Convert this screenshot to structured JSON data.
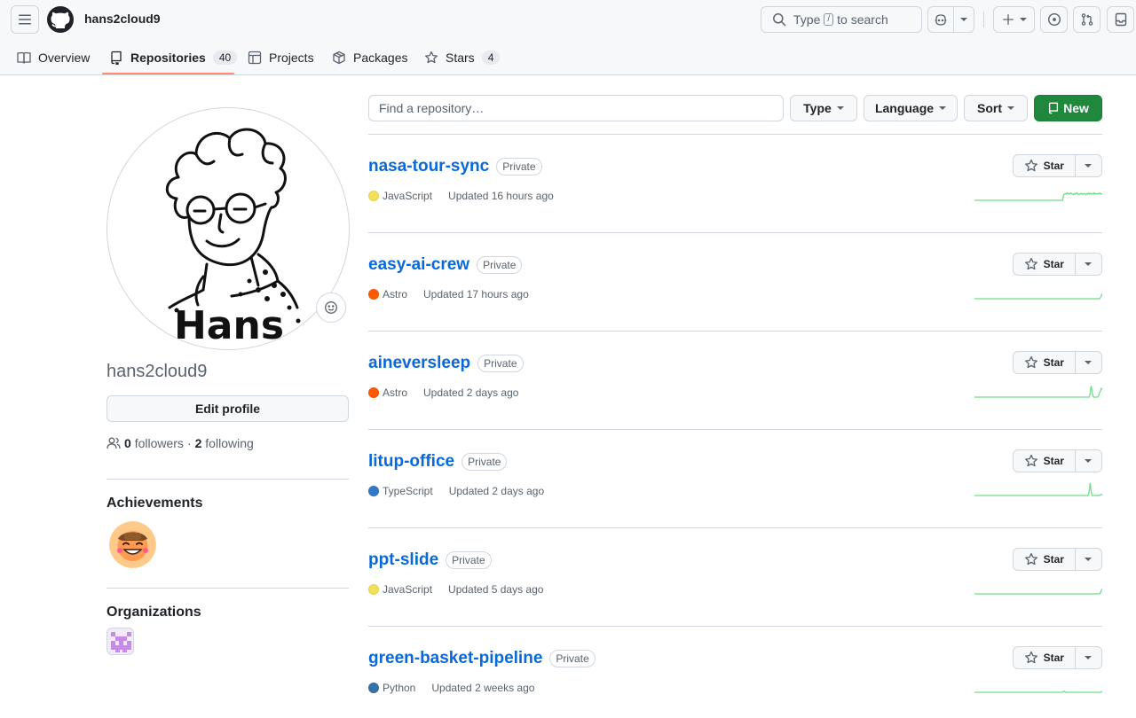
{
  "header": {
    "username": "hans2cloud9",
    "search_prefix": "Type",
    "search_key": "/",
    "search_suffix": "to search"
  },
  "tabs": [
    {
      "label": "Overview",
      "count": ""
    },
    {
      "label": "Repositories",
      "count": "40"
    },
    {
      "label": "Projects",
      "count": ""
    },
    {
      "label": "Packages",
      "count": ""
    },
    {
      "label": "Stars",
      "count": "4"
    }
  ],
  "profile": {
    "name": "hans2cloud9",
    "edit_label": "Edit profile",
    "followers_count": "0",
    "followers_label": "followers",
    "separator": "·",
    "following_count": "2",
    "following_label": "following",
    "avatar_text": "Hans",
    "achievements_title": "Achievements",
    "organizations_title": "Organizations"
  },
  "filters": {
    "find_placeholder": "Find a repository…",
    "type_label": "Type",
    "language_label": "Language",
    "sort_label": "Sort",
    "new_label": "New"
  },
  "colors": {
    "link": "#0969da",
    "primary_green": "#1f883d",
    "tab_underline": "#fd8c73",
    "spark_green": "#6fdd8b"
  },
  "repos": [
    {
      "name": "nasa-tour-sync",
      "visibility": "Private",
      "language": "JavaScript",
      "lang_color": "#f1e05a",
      "updated": "Updated 16 hours ago",
      "star_label": "Star",
      "activity": [
        0,
        0,
        0,
        0,
        0,
        0,
        0,
        0,
        0,
        0,
        0,
        0,
        0,
        0,
        0,
        0,
        0,
        0,
        0,
        0,
        0,
        0,
        0,
        0,
        0,
        0,
        0,
        0,
        0,
        0,
        0,
        0,
        0,
        0,
        0,
        0,
        0,
        0,
        0,
        0,
        0,
        0,
        0,
        0,
        0,
        0,
        0,
        0,
        0,
        0,
        0,
        0,
        0,
        0,
        0,
        0,
        0,
        0,
        0,
        0,
        0,
        0,
        0,
        0,
        0,
        0,
        0,
        0,
        0,
        0,
        0,
        0,
        0,
        0,
        0,
        0,
        0,
        0,
        0,
        0,
        0,
        0,
        0,
        0,
        0,
        0,
        0,
        0,
        0,
        0,
        0,
        0,
        0,
        0,
        0,
        0,
        0,
        0,
        0,
        0.45,
        0.5,
        0.55,
        0.5,
        0.6,
        0.55,
        0.5,
        0.55,
        0.6,
        0.55,
        0.5,
        0.45,
        0.55,
        0.5,
        0.55,
        0.6,
        0.5,
        0.45,
        0.5,
        0.55,
        0.5,
        0.55,
        0.5,
        0.55,
        0.5,
        0.45,
        0.55,
        0.5,
        0.6,
        0.5,
        0.55,
        0.5,
        0.55,
        0.5,
        0.6,
        0.5,
        0.55,
        0.5,
        0.55,
        0.5,
        0.6,
        0.55,
        0.5,
        0.55
      ]
    },
    {
      "name": "easy-ai-crew",
      "visibility": "Private",
      "language": "Astro",
      "lang_color": "#ff5a03",
      "updated": "Updated 17 hours ago",
      "star_label": "Star",
      "activity": [
        0,
        0,
        0,
        0,
        0,
        0,
        0,
        0,
        0,
        0,
        0,
        0,
        0,
        0,
        0,
        0,
        0,
        0,
        0,
        0,
        0,
        0,
        0,
        0,
        0,
        0,
        0,
        0,
        0,
        0,
        0,
        0,
        0,
        0,
        0,
        0,
        0,
        0,
        0,
        0,
        0,
        0,
        0,
        0,
        0,
        0,
        0,
        0,
        0,
        0,
        0,
        0,
        0,
        0,
        0,
        0,
        0,
        0,
        0,
        0,
        0,
        0,
        0,
        0,
        0,
        0,
        0,
        0,
        0,
        0,
        0,
        0,
        0,
        0,
        0,
        0,
        0,
        0,
        0,
        0,
        0,
        0,
        0,
        0,
        0,
        0,
        0,
        0,
        0,
        0,
        0,
        0,
        0,
        0,
        0,
        0,
        0,
        0,
        0,
        0,
        0,
        0,
        0,
        0,
        0,
        0,
        0,
        0,
        0,
        0,
        0,
        0,
        0,
        0,
        0,
        0,
        0,
        0,
        0,
        0,
        0,
        0,
        0,
        0,
        0,
        0,
        0,
        0,
        0,
        0,
        0,
        0,
        0,
        0,
        0,
        0,
        0,
        0,
        0,
        0,
        0.1,
        0.25,
        0.4
      ]
    },
    {
      "name": "aineversleep",
      "visibility": "Private",
      "language": "Astro",
      "lang_color": "#ff5a03",
      "updated": "Updated 2 days ago",
      "star_label": "Star",
      "activity": [
        0,
        0,
        0,
        0,
        0,
        0,
        0,
        0,
        0,
        0,
        0,
        0,
        0,
        0,
        0,
        0,
        0,
        0,
        0,
        0,
        0,
        0,
        0,
        0,
        0,
        0,
        0,
        0,
        0,
        0,
        0,
        0,
        0,
        0,
        0,
        0,
        0,
        0,
        0,
        0,
        0,
        0,
        0,
        0,
        0,
        0,
        0,
        0,
        0,
        0,
        0,
        0,
        0,
        0,
        0,
        0,
        0,
        0,
        0,
        0,
        0,
        0,
        0,
        0,
        0,
        0,
        0,
        0,
        0,
        0,
        0,
        0,
        0,
        0,
        0,
        0,
        0,
        0,
        0,
        0,
        0,
        0,
        0,
        0,
        0,
        0,
        0,
        0,
        0,
        0,
        0,
        0,
        0,
        0,
        0,
        0,
        0,
        0,
        0,
        0,
        0,
        0,
        0,
        0,
        0,
        0,
        0,
        0,
        0,
        0,
        0,
        0,
        0,
        0,
        0,
        0,
        0,
        0,
        0,
        0,
        0,
        0,
        0,
        0,
        0.3,
        0.9,
        0.5,
        0.1,
        0,
        0,
        0,
        0,
        0,
        0.1,
        0.3,
        0.5,
        0.7,
        0.6
      ]
    },
    {
      "name": "litup-office",
      "visibility": "Private",
      "language": "TypeScript",
      "lang_color": "#3178c6",
      "updated": "Updated 2 days ago",
      "star_label": "Star",
      "activity": [
        0,
        0,
        0,
        0,
        0,
        0,
        0,
        0,
        0,
        0,
        0,
        0,
        0,
        0,
        0,
        0,
        0,
        0,
        0,
        0,
        0,
        0,
        0,
        0,
        0,
        0,
        0,
        0,
        0,
        0,
        0,
        0,
        0,
        0,
        0,
        0,
        0,
        0,
        0,
        0,
        0,
        0,
        0,
        0,
        0,
        0,
        0,
        0,
        0,
        0,
        0,
        0,
        0,
        0,
        0,
        0,
        0,
        0,
        0,
        0,
        0,
        0,
        0,
        0,
        0,
        0,
        0,
        0,
        0,
        0,
        0,
        0,
        0,
        0,
        0,
        0,
        0,
        0,
        0,
        0,
        0,
        0,
        0,
        0,
        0,
        0,
        0,
        0,
        0,
        0,
        0,
        0,
        0,
        0,
        0,
        0,
        0,
        0,
        0,
        0,
        0,
        0,
        0,
        0,
        0,
        0,
        0,
        0,
        0,
        0,
        0,
        0,
        0,
        0,
        0,
        0,
        0,
        0,
        0,
        0,
        0,
        0,
        0,
        0.4,
        1,
        0.4,
        0,
        0,
        0,
        0,
        0,
        0,
        0,
        0,
        0,
        0.05,
        0.1,
        0.05
      ]
    },
    {
      "name": "ppt-slide",
      "visibility": "Private",
      "language": "JavaScript",
      "lang_color": "#f1e05a",
      "updated": "Updated 5 days ago",
      "star_label": "Star",
      "activity": [
        0,
        0,
        0,
        0,
        0,
        0,
        0,
        0,
        0,
        0,
        0,
        0,
        0,
        0,
        0,
        0,
        0,
        0,
        0,
        0,
        0,
        0,
        0,
        0,
        0,
        0,
        0,
        0,
        0,
        0,
        0,
        0,
        0,
        0,
        0,
        0,
        0,
        0,
        0,
        0,
        0,
        0,
        0,
        0,
        0,
        0,
        0,
        0,
        0,
        0,
        0,
        0,
        0,
        0,
        0,
        0,
        0,
        0,
        0,
        0,
        0,
        0,
        0,
        0,
        0,
        0,
        0,
        0,
        0,
        0,
        0,
        0,
        0,
        0,
        0,
        0,
        0,
        0,
        0,
        0,
        0,
        0,
        0,
        0,
        0,
        0,
        0,
        0,
        0,
        0,
        0,
        0,
        0,
        0,
        0,
        0,
        0,
        0,
        0,
        0,
        0,
        0,
        0,
        0,
        0,
        0,
        0,
        0,
        0,
        0,
        0,
        0,
        0,
        0,
        0,
        0,
        0,
        0,
        0,
        0,
        0,
        0,
        0,
        0,
        0,
        0,
        0,
        0,
        0,
        0,
        0,
        0,
        0,
        0,
        0,
        0,
        0,
        0,
        0,
        0,
        0.1,
        0.3,
        0.4
      ]
    },
    {
      "name": "green-basket-pipeline",
      "visibility": "Private",
      "language": "Python",
      "lang_color": "#3572a5",
      "updated": "Updated 2 weeks ago",
      "star_label": "Star",
      "activity": [
        0,
        0,
        0,
        0,
        0,
        0,
        0,
        0,
        0,
        0,
        0,
        0,
        0,
        0,
        0,
        0,
        0,
        0,
        0,
        0,
        0,
        0,
        0,
        0,
        0,
        0,
        0,
        0,
        0,
        0,
        0,
        0,
        0,
        0,
        0,
        0,
        0,
        0,
        0,
        0,
        0,
        0,
        0,
        0,
        0,
        0,
        0,
        0,
        0,
        0,
        0,
        0,
        0,
        0,
        0,
        0,
        0,
        0,
        0,
        0,
        0,
        0,
        0,
        0,
        0,
        0,
        0,
        0,
        0,
        0,
        0,
        0,
        0,
        0,
        0,
        0,
        0,
        0,
        0,
        0,
        0,
        0,
        0,
        0,
        0,
        0,
        0,
        0,
        0,
        0,
        0,
        0,
        0,
        0,
        0,
        0,
        0,
        0,
        0,
        0,
        0.1,
        0.05,
        0,
        0,
        0,
        0,
        0,
        0,
        0,
        0,
        0,
        0,
        0,
        0,
        0,
        0,
        0,
        0,
        0,
        0,
        0,
        0,
        0,
        0,
        0,
        0,
        0,
        0,
        0,
        0,
        0,
        0,
        0,
        0,
        0,
        0,
        0,
        0,
        0,
        0,
        0,
        0,
        0.05,
        0.1
      ]
    }
  ]
}
